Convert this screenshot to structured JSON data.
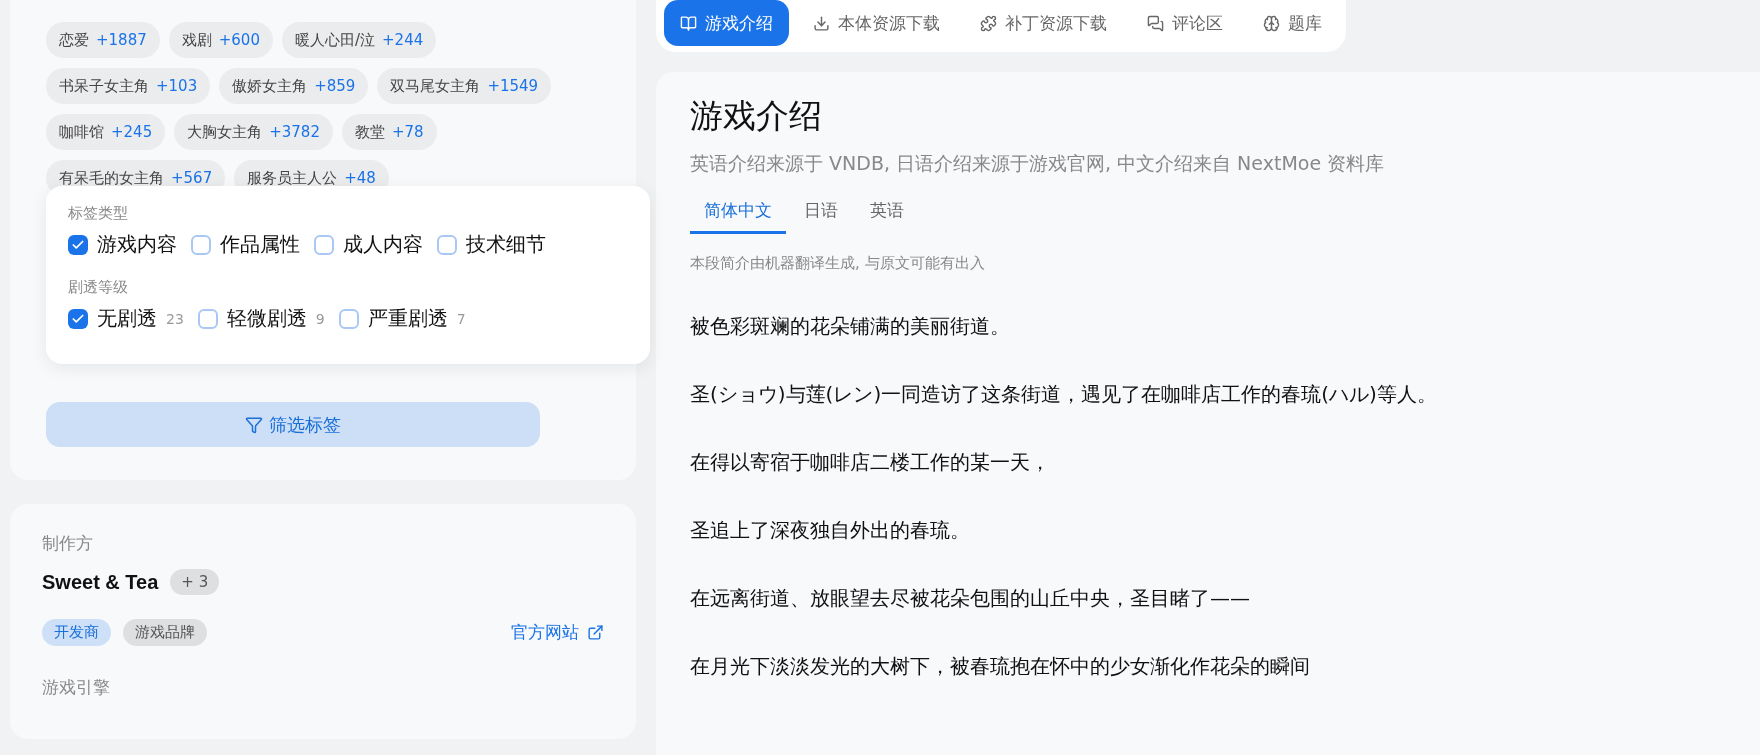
{
  "tags": [
    {
      "name": "恋爱",
      "count": "+1887"
    },
    {
      "name": "戏剧",
      "count": "+600"
    },
    {
      "name": "暖人心田/泣",
      "count": "+244"
    },
    {
      "name": "书呆子女主角",
      "count": "+103"
    },
    {
      "name": "傲娇女主角",
      "count": "+859"
    },
    {
      "name": "双马尾女主角",
      "count": "+1549"
    },
    {
      "name": "咖啡馆",
      "count": "+245"
    },
    {
      "name": "大胸女主角",
      "count": "+3782"
    },
    {
      "name": "教堂",
      "count": "+78"
    },
    {
      "name": "有呆毛的女主角",
      "count": "+567"
    },
    {
      "name": "服务员主人公",
      "count": "+48"
    }
  ],
  "filter_popup": {
    "sections": [
      {
        "title": "标签类型",
        "options": [
          {
            "label": "游戏内容",
            "checked": true
          },
          {
            "label": "作品属性",
            "checked": false
          },
          {
            "label": "成人内容",
            "checked": false
          },
          {
            "label": "技术细节",
            "checked": false
          }
        ]
      },
      {
        "title": "剧透等级",
        "options": [
          {
            "label": "无剧透",
            "count": "23",
            "checked": true
          },
          {
            "label": "轻微剧透",
            "count": "9",
            "checked": false
          },
          {
            "label": "严重剧透",
            "count": "7",
            "checked": false
          }
        ]
      }
    ]
  },
  "filter_button": "筛选标签",
  "producer": {
    "label": "制作方",
    "name": "Sweet & Tea",
    "extra": "+ 3",
    "roles": [
      {
        "label": "开发商",
        "kind": "primary"
      },
      {
        "label": "游戏品牌",
        "kind": "default"
      }
    ],
    "link": "官方网站"
  },
  "engine": {
    "label": "游戏引擎"
  },
  "nav_tabs": [
    {
      "label": "游戏介绍",
      "selected": true
    },
    {
      "label": "本体资源下载",
      "selected": false
    },
    {
      "label": "补丁资源下载",
      "selected": false
    },
    {
      "label": "评论区",
      "selected": false
    },
    {
      "label": "题库",
      "selected": false
    }
  ],
  "intro": {
    "title": "游戏介绍",
    "source_note": "英语介绍来源于 VNDB, 日语介绍来源于游戏官网, 中文介绍来自 NextMoe 资料库",
    "lang_tabs": [
      {
        "label": "简体中文",
        "selected": true
      },
      {
        "label": "日语",
        "selected": false
      },
      {
        "label": "英语",
        "selected": false
      }
    ],
    "translation_note": "本段简介由机器翻译生成, 与原文可能有出入",
    "paragraphs": [
      "被色彩斑斓的花朵铺满的美丽街道。",
      "圣(ショウ)与莲(レン)一同造访了这条街道，遇见了在咖啡店工作的春琉(ハル)等人。",
      "在得以寄宿于咖啡店二楼工作的某一天，",
      "圣追上了深夜独自外出的春琉。",
      "在远离街道、放眼望去尽被花朵包围的山丘中央，圣目睹了——",
      "在月光下淡淡发光的大树下，被春琉抱在怀中的少女渐化作花朵的瞬间"
    ]
  }
}
